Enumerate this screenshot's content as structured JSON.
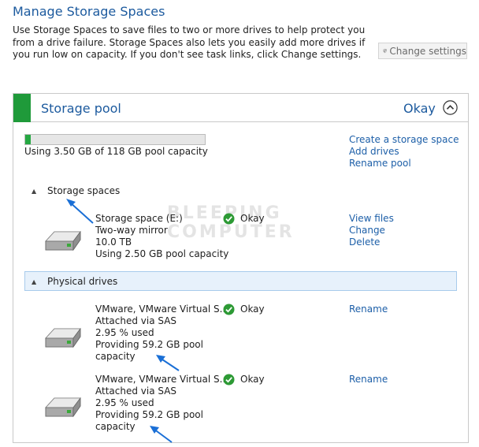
{
  "page": {
    "title": "Manage Storage Spaces",
    "description": "Use Storage Spaces to save files to two or more drives to help protect you from a drive failure. Storage Spaces also lets you easily add more drives if you run low on capacity. If you don't see task links, click Change settings.",
    "change_settings_label": "Change settings"
  },
  "pool": {
    "title": "Storage pool",
    "status": "Okay",
    "capacity_used_fraction": 0.03,
    "capacity_text": "Using 3.50 GB of 118 GB pool capacity",
    "links": [
      "Create a storage space",
      "Add drives",
      "Rename pool"
    ]
  },
  "storage_spaces": {
    "section_label": "Storage spaces",
    "items": [
      {
        "name": "Storage space (E:)",
        "status": "Okay",
        "resiliency": "Two-way mirror",
        "size": "10.0 TB",
        "usage": "Using 2.50 GB pool capacity",
        "links": [
          "View files",
          "Change",
          "Delete"
        ]
      }
    ]
  },
  "physical_drives": {
    "section_label": "Physical drives",
    "items": [
      {
        "name": "VMware, VMware Virtual S...",
        "status": "Okay",
        "attached": "Attached via SAS",
        "used": "2.95 % used",
        "providing_line1": "Providing 59.2 GB pool",
        "providing_line2": "capacity",
        "link": "Rename"
      },
      {
        "name": "VMware, VMware Virtual S...",
        "status": "Okay",
        "attached": "Attached via SAS",
        "used": "2.95 % used",
        "providing_line1": "Providing 59.2 GB pool",
        "providing_line2": "capacity",
        "link": "Rename"
      }
    ]
  },
  "watermark": {
    "line1": "BLEEPING",
    "line2": "COMPUTER"
  },
  "colors": {
    "accent_blue": "#1c5a9e",
    "link_blue": "#1d5fa8",
    "ok_green": "#1f9a3a",
    "section_highlight": "#e7f1fb",
    "annotation_arrow": "#1a6fd6"
  },
  "icons": {
    "settings": "uac-shield-icon",
    "collapse": "chevron-up-icon",
    "status": "checkmark-circle-icon",
    "drive": "hard-drive-icon",
    "section_toggle": "triangle-icon"
  }
}
